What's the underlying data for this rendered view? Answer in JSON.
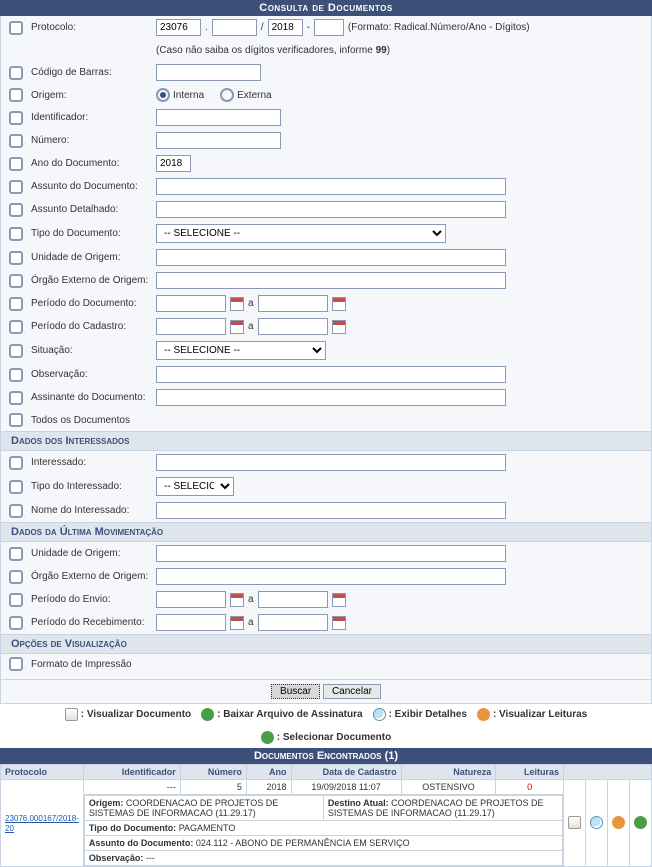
{
  "header": "Consulta de Documentos",
  "form": {
    "protocolo": {
      "label": "Protocolo:",
      "radical": "23076",
      "numero": "",
      "ano": "2018",
      "digitos": "",
      "hint": "(Formato: Radical.Número/Ano - Dígitos)",
      "hint2_a": "(Caso não saiba os dígitos verificadores, informe ",
      "hint2_b": "99",
      "hint2_c": ")"
    },
    "codigo_barras": {
      "label": "Código de Barras:"
    },
    "origem": {
      "label": "Origem:",
      "opt_interna": "Interna",
      "opt_externa": "Externa"
    },
    "identificador": {
      "label": "Identificador:"
    },
    "numero": {
      "label": "Número:"
    },
    "ano_doc": {
      "label": "Ano do Documento:",
      "value": "2018"
    },
    "assunto_doc": {
      "label": "Assunto do Documento:"
    },
    "assunto_det": {
      "label": "Assunto Detalhado:"
    },
    "tipo_doc": {
      "label": "Tipo do Documento:",
      "value": "-- SELECIONE --"
    },
    "unidade_origem": {
      "label": "Unidade de Origem:"
    },
    "orgao_externo": {
      "label": "Órgão Externo de Origem:"
    },
    "periodo_doc": {
      "label": "Período do Documento:",
      "sep": "a"
    },
    "periodo_cad": {
      "label": "Período do Cadastro:",
      "sep": "a"
    },
    "situacao": {
      "label": "Situação:",
      "value": "-- SELECIONE --"
    },
    "observacao": {
      "label": "Observação:"
    },
    "assinante": {
      "label": "Assinante do Documento:"
    },
    "todos": {
      "label": "Todos os Documentos"
    }
  },
  "interessados": {
    "header": "Dados dos Interessados",
    "interessado": {
      "label": "Interessado:"
    },
    "tipo": {
      "label": "Tipo do Interessado:",
      "value": "-- SELECIONE --"
    },
    "nome": {
      "label": "Nome do Interessado:"
    }
  },
  "mov": {
    "header": "Dados da Última Movimentação",
    "unidade": {
      "label": "Unidade de Origem:"
    },
    "orgao": {
      "label": "Órgão Externo de Origem:"
    },
    "envio": {
      "label": "Período do Envio:",
      "sep": "a"
    },
    "receb": {
      "label": "Período do Recebimento:",
      "sep": "a"
    }
  },
  "viz": {
    "header": "Opções de Visualização",
    "formato": {
      "label": "Formato de Impressão"
    }
  },
  "buttons": {
    "buscar": "Buscar",
    "cancelar": "Cancelar"
  },
  "legend": {
    "doc": ": Visualizar Documento",
    "down": ": Baixar Arquivo de Assinatura",
    "zoom": ": Exibir Detalhes",
    "user": ": Visualizar Leituras",
    "sel": ": Selecionar Documento"
  },
  "results": {
    "header": "Documentos Encontrados (1)",
    "cols": {
      "protocolo": "Protocolo",
      "identificador": "Identificador",
      "numero": "Número",
      "ano": "Ano",
      "data": "Data de Cadastro",
      "natureza": "Natureza",
      "leituras": "Leituras"
    },
    "rows": [
      {
        "protocolo": "23076.000167/2018-20",
        "identificador": "---",
        "numero": "5",
        "ano": "2018",
        "data": "19/09/2018 11:07",
        "natureza": "OSTENSIVO",
        "leituras": "0",
        "detail": {
          "origem_lbl": "Origem:",
          "origem_val": "COORDENACAO DE PROJETOS DE SISTEMAS DE INFORMACAO (11.29.17)",
          "destino_lbl": "Destino Atual:",
          "destino_val": "COORDENACAO DE PROJETOS DE SISTEMAS DE INFORMACAO (11.29.17)",
          "tipo_lbl": "Tipo do Documento:",
          "tipo_val": "PAGAMENTO",
          "assunto_lbl": "Assunto do Documento:",
          "assunto_val": "024.112 - ABONO DE PERMANÊNCIA EM SERVIÇO",
          "obs_lbl": "Observação:",
          "obs_val": "---"
        }
      }
    ]
  }
}
